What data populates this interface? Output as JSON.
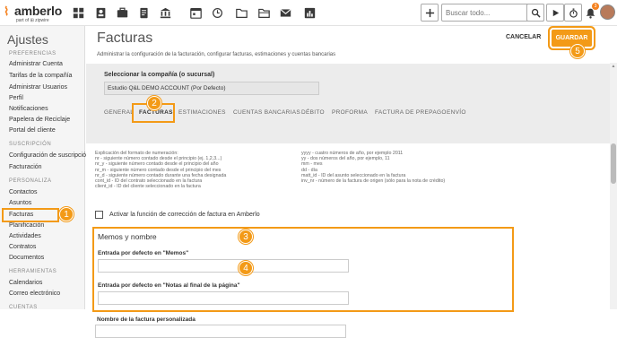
{
  "brand": {
    "logo_text": "amberlo",
    "logo_sub": "part of  ⊞ zipwire"
  },
  "topbar": {
    "search_placeholder": "Buscar todo...",
    "notification_count": "3"
  },
  "sidebar": {
    "title": "Ajustes",
    "sections": [
      {
        "label": "PREFERENCIAS",
        "items": [
          "Administrar Cuenta",
          "Tarifas de la compañía",
          "Administrar Usuarios",
          "Perfil",
          "Notificaciones",
          "Papelera de Reciclaje",
          "Portal del cliente"
        ]
      },
      {
        "label": "SUSCRIPCIÓN",
        "items": [
          "Configuración de suscripción",
          "Facturación"
        ]
      },
      {
        "label": "PERSONALIZA",
        "items": [
          "Contactos",
          "Asuntos",
          "Facturas",
          "Planificación",
          "Actividades",
          "Contratos",
          "Documentos"
        ]
      },
      {
        "label": "HERRAMIENTAS",
        "items": [
          "Calendarios",
          "Correo electrónico"
        ]
      },
      {
        "label": "CUENTAS",
        "items": []
      }
    ]
  },
  "header": {
    "title": "Facturas",
    "subtitle": "Administrar la configuración de la facturación, configurar facturas, estimaciones y cuentas bancarias",
    "cancel_label": "CANCELAR",
    "save_label": "GUARDAR"
  },
  "company": {
    "label": "Seleccionar la compañía (o sucursal)",
    "value": "Estudio Q&L DEMO ACCOUNT (Por Defecto)"
  },
  "tabs": [
    "GENERAL",
    "FACTURAS",
    "ESTIMACIONES",
    "CUENTAS BANCARIAS",
    "DÉBITO",
    "PROFORMA",
    "FACTURA DE PREPAGO",
    "ENVÍO"
  ],
  "explanation": {
    "left": [
      "Explicación del formato de numeración:",
      "nr - siguiente número contado desde el principio (ej. 1,2,3...)",
      "nr_y - siguiente número contado desde el principio del año",
      "nr_m - siguiente número contado desde el principio del mes",
      "nr_d - siguiente número contado durante una fecha designada",
      "cont_id - ID del contrato seleccionado en la factura",
      "client_id - ID del cliente seleccionado en la factura"
    ],
    "right": [
      "yyyy - cuatro números de año, por ejemplo 2011",
      "yy - dos números del año, por ejemplo, 11",
      "mm - mes",
      "dd - día",
      "matt_id - ID del asunto seleccionado en la factura",
      "inv_nr - número de la factura de origen (sólo para la nota de crédito)"
    ]
  },
  "correction_checkbox_label": "Activar la función de corrección de factura en Amberlo",
  "memos": {
    "title": "Memos y nombre",
    "memo_label": "Entrada por defecto en \"Memos\"",
    "notes_label": "Entrada por defecto en \"Notas al final de la página\""
  },
  "invoice_name_label": "Nombre de la factura personalizada",
  "callouts": [
    "1",
    "2",
    "3",
    "4",
    "5"
  ],
  "colors": {
    "accent": "#f39a17",
    "brand": "#f58220"
  }
}
